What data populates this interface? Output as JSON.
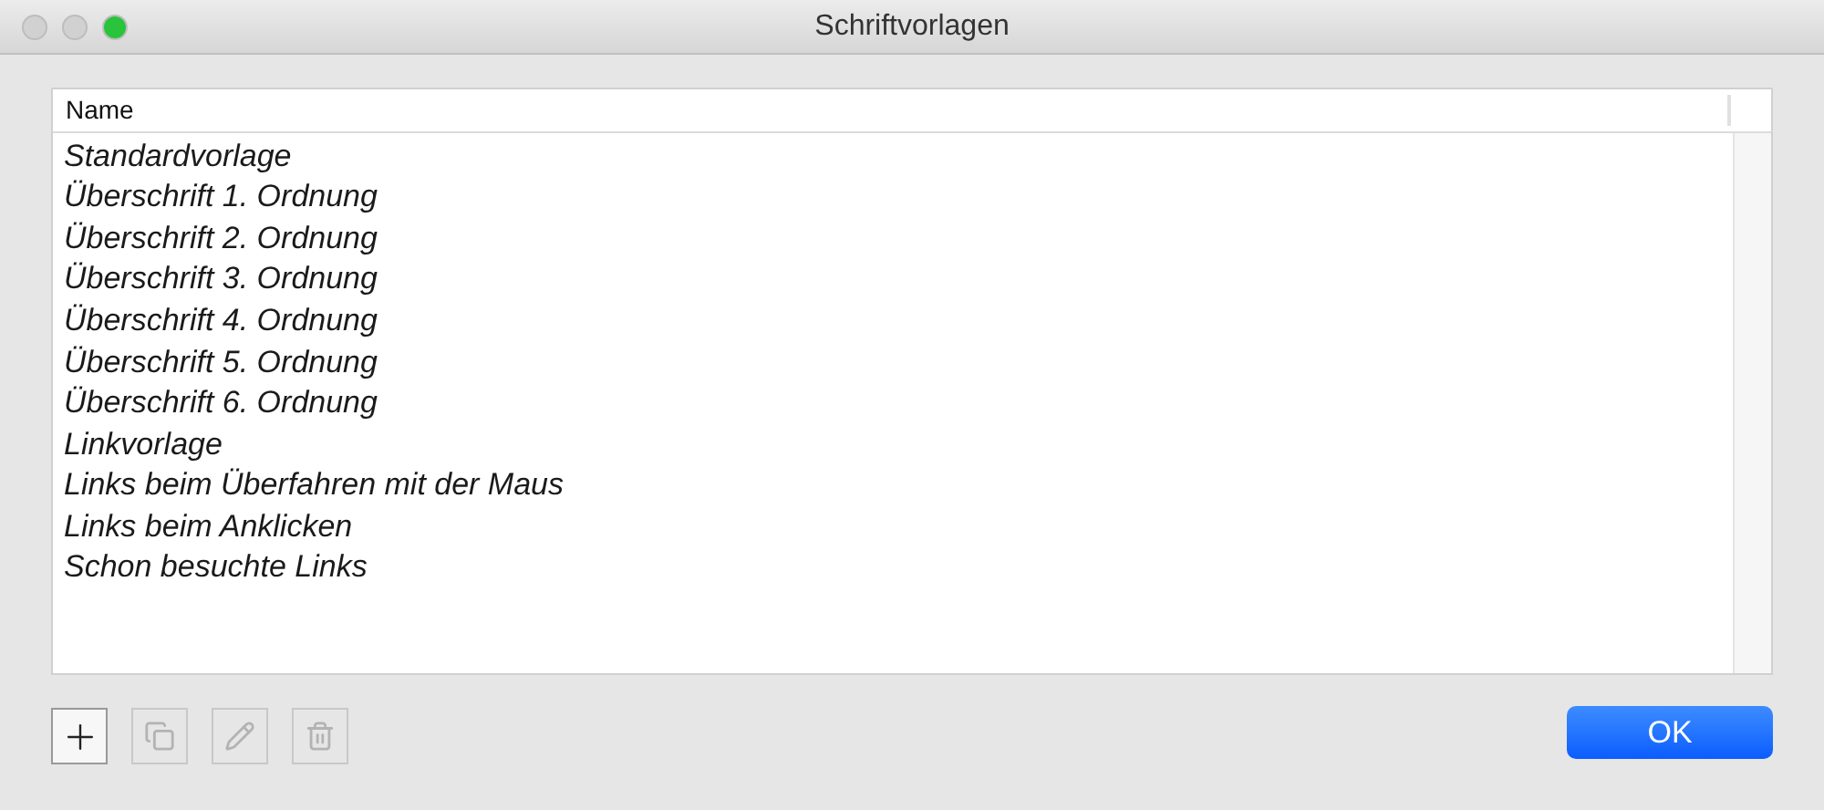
{
  "window": {
    "title": "Schriftvorlagen",
    "controls": [
      {
        "color": "#d1d1d1"
      },
      {
        "color": "#d1d1d1"
      },
      {
        "color": "#2ac33c"
      }
    ]
  },
  "table": {
    "columns": [
      "Name"
    ],
    "rows": [
      "Standardvorlage",
      "Überschrift 1. Ordnung",
      "Überschrift 2. Ordnung",
      "Überschrift 3. Ordnung",
      "Überschrift 4. Ordnung",
      "Überschrift 5. Ordnung",
      "Überschrift 6. Ordnung",
      "Linkvorlage",
      "Links beim Überfahren mit der Maus",
      "Links beim Anklicken",
      "Schon besuchte Links"
    ]
  },
  "toolbar": [
    {
      "kind": "add",
      "disabled": false
    },
    {
      "kind": "duplicate",
      "disabled": true
    },
    {
      "kind": "edit",
      "disabled": true
    },
    {
      "kind": "delete",
      "disabled": true
    }
  ],
  "buttons": [
    {
      "label": "OK"
    }
  ]
}
